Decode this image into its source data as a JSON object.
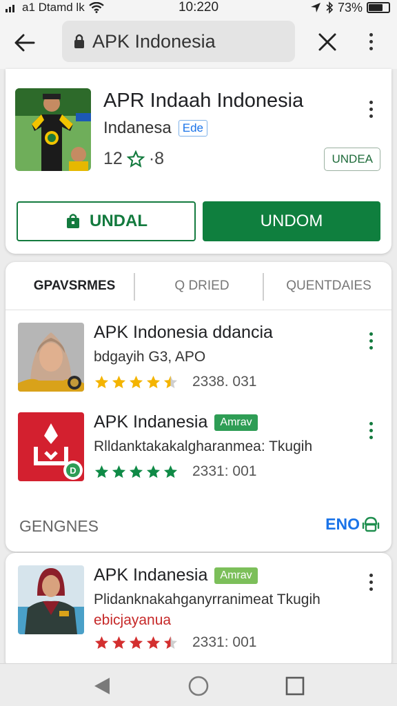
{
  "status_bar": {
    "carrier": "a1 Dtamd lk",
    "time": "10:220",
    "battery": "73%",
    "battery_level": 0.73
  },
  "app_bar": {
    "search_text": "APK Indonesia",
    "back_icon": "arrow-left-icon",
    "clear_icon": "close-icon",
    "menu_icon": "more-vert-icon"
  },
  "featured_app": {
    "title": "APR Indaah Indonesia",
    "developer": "Indanesa",
    "tag": "Ede",
    "rating": "12",
    "rating_suffix": "·8",
    "chip": "UNDEA",
    "outline_button": "UNDAL",
    "filled_button": "UNDOM"
  },
  "tabs": [
    {
      "label": "GPAVSRMES",
      "active": true
    },
    {
      "label": "Q DRIED",
      "active": false
    },
    {
      "label": "QUENTDAIES",
      "active": false
    }
  ],
  "items": [
    {
      "title": "APK Indonesia ddancia",
      "badge": "",
      "subtitle": "bdgayih G3, APO",
      "extra": "",
      "count": "2338. 031",
      "rating": 4.5,
      "star_color": "#f4b400"
    },
    {
      "title": "APK Indanesia",
      "badge": "Amrav",
      "subtitle": "Rlldanktakakalgharanmea: Tkugih",
      "extra": "",
      "count": "2331: 001",
      "rating": 5,
      "star_color": "#0f8a46"
    }
  ],
  "section": {
    "title": "GENGNES",
    "action": "ENO"
  },
  "bottom_item": {
    "title": "APK Indanesia",
    "badge": "Amrav",
    "subtitle": "Plidanknakahganyrranimeat Tkugih",
    "extra": "ebicjayanua",
    "count": "2331: 001",
    "rating": 4.5,
    "star_color": "#d32f2f"
  },
  "colors": {
    "accent_green": "#0f7f3e",
    "link_blue": "#1a73e8"
  }
}
